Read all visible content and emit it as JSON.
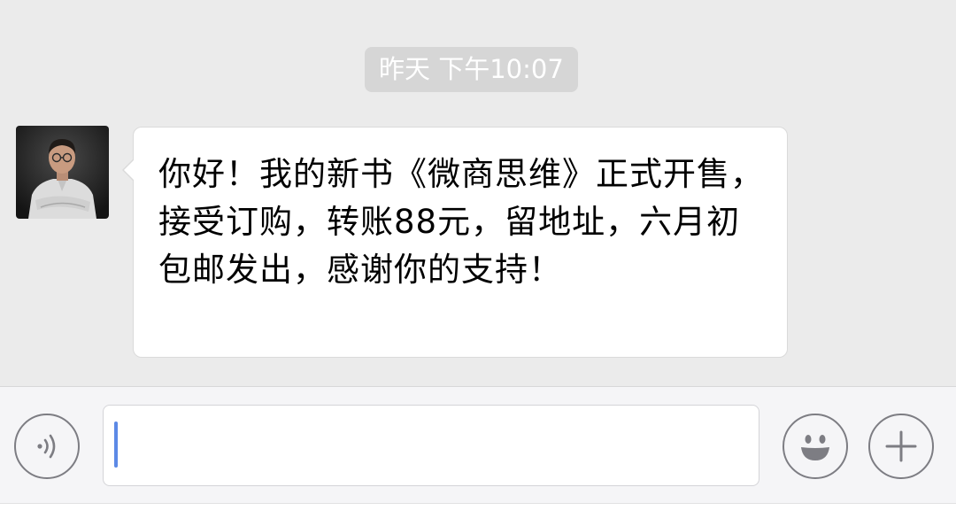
{
  "chat": {
    "timestamp": "昨天 下午10:07",
    "messages": [
      {
        "sender": "contact",
        "text": "你好！我的新书《微商思维》正式开售，接受订购，转账88元，留地址，六月初包邮发出，感谢你的支持！"
      }
    ]
  },
  "input_bar": {
    "value": "",
    "icons": {
      "voice": "voice-icon",
      "emoji": "emoji-icon",
      "more": "plus-icon"
    }
  },
  "colors": {
    "chat_background": "#ebebeb",
    "timestamp_background": "#d6d6d6",
    "bubble_background": "#ffffff",
    "input_bar_background": "#f5f5f7",
    "icon_stroke": "#7d7d83",
    "cursor": "#5c89e6"
  }
}
